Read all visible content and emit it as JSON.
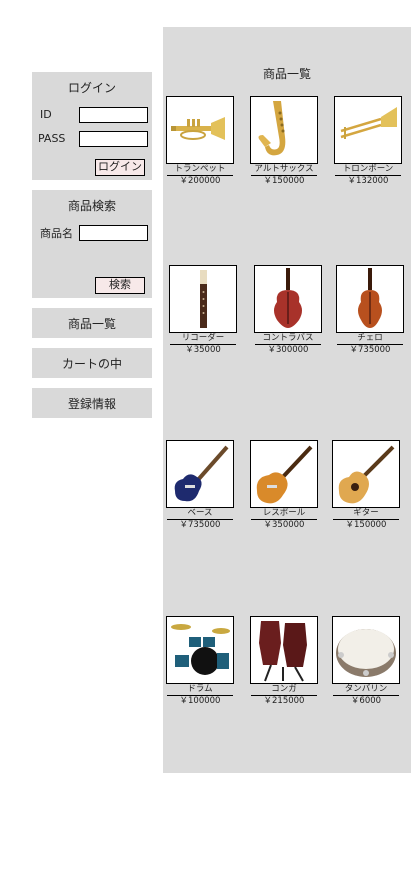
{
  "sidebar": {
    "login": {
      "title": "ログイン",
      "id_label": "ID",
      "pass_label": "PASS",
      "id_value": "",
      "pass_value": "",
      "button": "ログイン"
    },
    "search": {
      "title": "商品検索",
      "name_label": "商品名",
      "name_value": "",
      "button": "検索"
    },
    "nav": [
      "商品一覧",
      "カートの中",
      "登録情報"
    ]
  },
  "main": {
    "title": "商品一覧",
    "products": [
      {
        "name": "トランペット",
        "price": "￥200000",
        "icon": "trumpet-icon"
      },
      {
        "name": "アルトサックス",
        "price": "￥150000",
        "icon": "alto-sax-icon"
      },
      {
        "name": "トロンボーン",
        "price": "￥132000",
        "icon": "trombone-icon"
      },
      {
        "name": "リコーダー",
        "price": "￥35000",
        "icon": "recorder-icon"
      },
      {
        "name": "コントラバス",
        "price": "￥300000",
        "icon": "contrabass-icon"
      },
      {
        "name": "チェロ",
        "price": "￥735000",
        "icon": "cello-icon"
      },
      {
        "name": "ベース",
        "price": "￥735000",
        "icon": "bass-guitar-icon"
      },
      {
        "name": "レスポール",
        "price": "￥350000",
        "icon": "les-paul-icon"
      },
      {
        "name": "ギター",
        "price": "￥150000",
        "icon": "acoustic-guitar-icon"
      },
      {
        "name": "ドラム",
        "price": "￥100000",
        "icon": "drum-kit-icon"
      },
      {
        "name": "コンガ",
        "price": "￥215000",
        "icon": "conga-icon"
      },
      {
        "name": "タンバリン",
        "price": "￥6000",
        "icon": "tambourine-icon"
      }
    ]
  }
}
